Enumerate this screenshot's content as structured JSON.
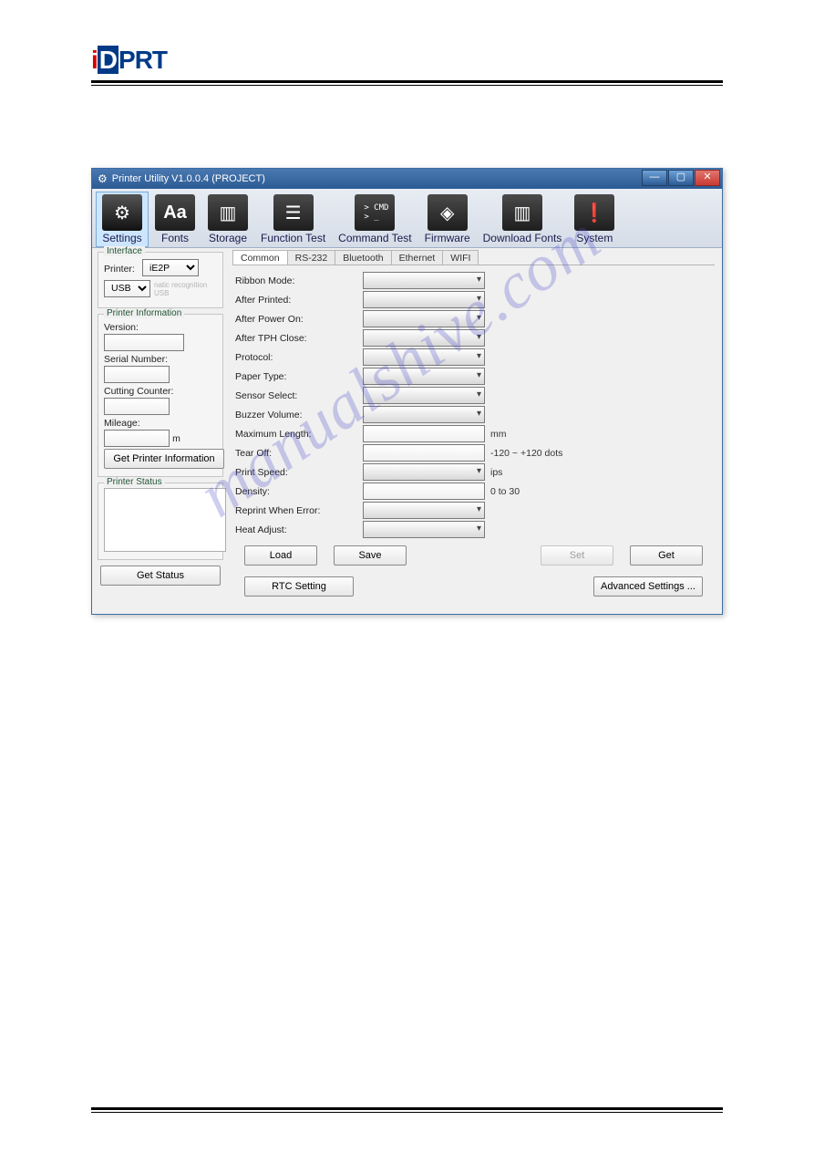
{
  "logo": {
    "i": "i",
    "d": "D",
    "prt": "PRT"
  },
  "window": {
    "title": "Printer Utility  V1.0.0.4  (PROJECT)"
  },
  "toolbar": {
    "items": [
      {
        "label": "Settings",
        "glyph": "⚙"
      },
      {
        "label": "Fonts",
        "glyph": "Aa"
      },
      {
        "label": "Storage",
        "glyph": "▤"
      },
      {
        "label": "Function Test",
        "glyph": "☰"
      },
      {
        "label": "Command Test",
        "glyph": "> CMD\n> _"
      },
      {
        "label": "Firmware",
        "glyph": "◈"
      },
      {
        "label": "Download Fonts",
        "glyph": "▤"
      },
      {
        "label": "System",
        "glyph": "❗"
      }
    ],
    "selected": "Settings"
  },
  "sidebar": {
    "interface": {
      "title": "Interface",
      "printer_label": "Printer:",
      "printer_value": "iE2P",
      "port_value": "USB",
      "auto_label": "natic recognition USB"
    },
    "info": {
      "title": "Printer Information",
      "version_label": "Version:",
      "serial_label": "Serial Number:",
      "cutting_label": "Cutting Counter:",
      "mileage_label": "Mileage:",
      "mileage_unit": "m",
      "get_info_btn": "Get Printer Information"
    },
    "status": {
      "title": "Printer Status",
      "get_status_btn": "Get Status"
    }
  },
  "tabs": [
    "Common",
    "RS-232",
    "Bluetooth",
    "Ethernet",
    "WIFI"
  ],
  "active_tab": "Common",
  "fields": {
    "ribbon_mode": "Ribbon Mode:",
    "after_printed": "After Printed:",
    "after_power_on": "After Power On:",
    "after_tph_close": "After TPH Close:",
    "protocol": "Protocol:",
    "paper_type": "Paper Type:",
    "sensor_select": "Sensor Select:",
    "buzzer_volume": "Buzzer Volume:",
    "maximum_length": "Maximum Length:",
    "maximum_length_unit": "mm",
    "tear_off": "Tear Off:",
    "tear_off_range": "-120 ~ +120 dots",
    "print_speed": "Print Speed:",
    "print_speed_unit": "ips",
    "density": "Density:",
    "density_range": "0 to 30",
    "reprint_when_error": "Reprint When Error:",
    "heat_adjust": "Heat Adjust:"
  },
  "buttons": {
    "load": "Load",
    "save": "Save",
    "set": "Set",
    "get": "Get",
    "rtc": "RTC Setting",
    "advanced": "Advanced Settings ..."
  },
  "watermark": "manualshive.com"
}
